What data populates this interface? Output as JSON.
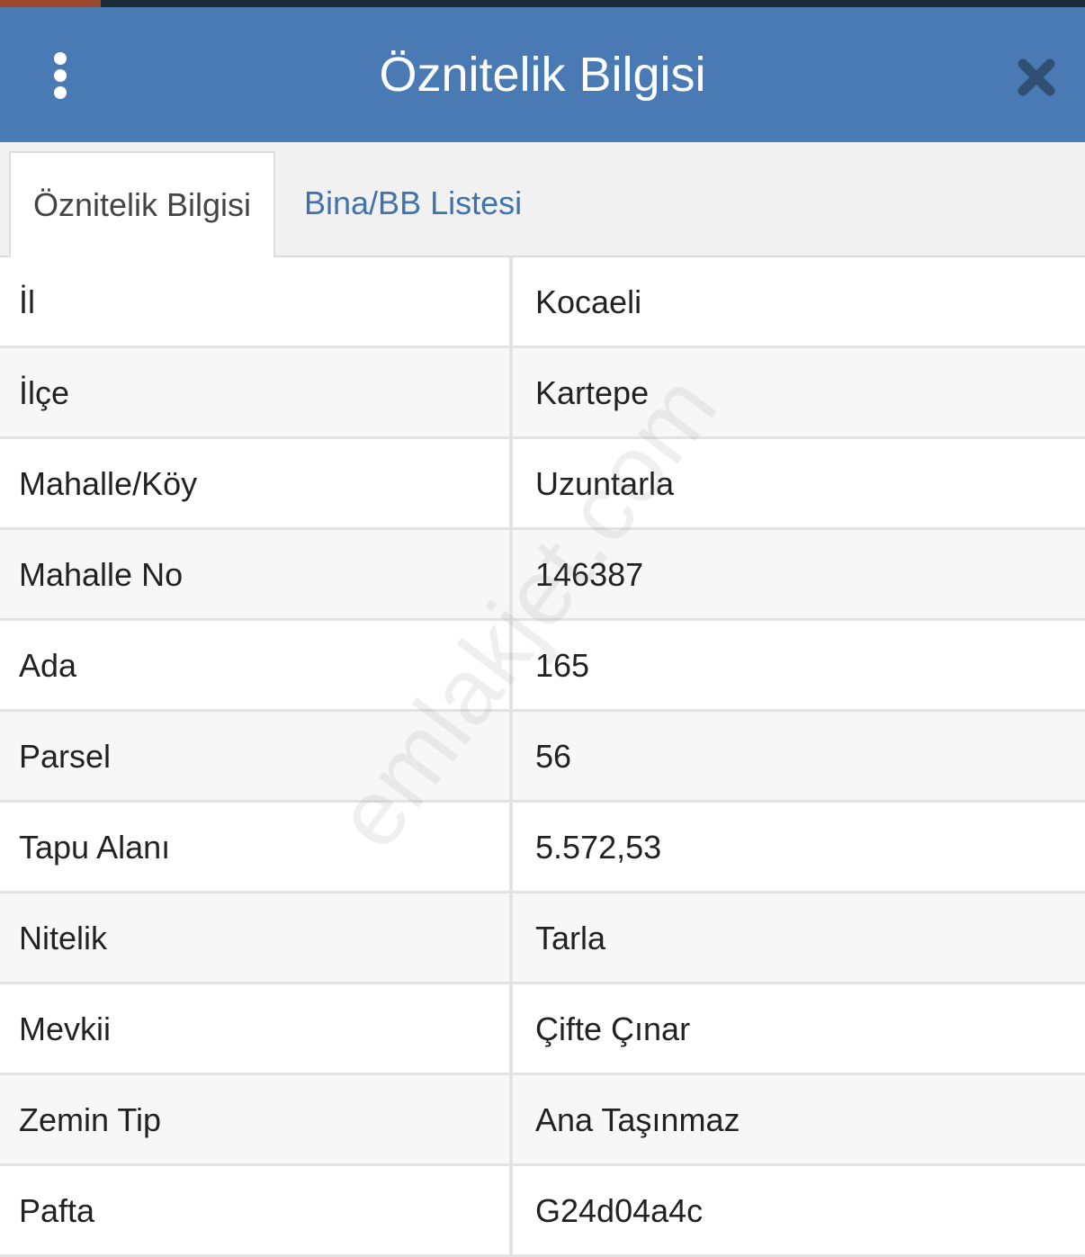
{
  "header": {
    "title": "Öznitelik Bilgisi",
    "menu_icon": "vertical-dots-icon",
    "close_icon": "close-icon",
    "color": "#4a7ab3"
  },
  "tabs": [
    {
      "label": "Öznitelik Bilgisi",
      "active": true
    },
    {
      "label": "Bina/BB Listesi",
      "active": false
    }
  ],
  "attributes": [
    {
      "key": "İl",
      "value": "Kocaeli"
    },
    {
      "key": "İlçe",
      "value": "Kartepe"
    },
    {
      "key": "Mahalle/Köy",
      "value": "Uzuntarla"
    },
    {
      "key": "Mahalle No",
      "value": "146387"
    },
    {
      "key": "Ada",
      "value": "165"
    },
    {
      "key": "Parsel",
      "value": "56"
    },
    {
      "key": "Tapu Alanı",
      "value": "5.572,53"
    },
    {
      "key": "Nitelik",
      "value": "Tarla"
    },
    {
      "key": "Mevkii",
      "value": "Çifte Çınar"
    },
    {
      "key": "Zemin Tip",
      "value": "Ana Taşınmaz"
    },
    {
      "key": "Pafta",
      "value": "G24d04a4c"
    }
  ],
  "watermark": "emlakjet.com"
}
